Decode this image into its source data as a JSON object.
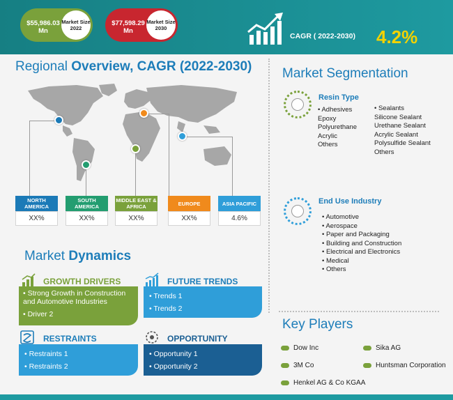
{
  "header": {
    "market_size_2022_value": "$55,986.03 Mn",
    "market_size_2022_label": "Market Size 2022",
    "market_size_2030_value": "$77,598.29 Mn",
    "market_size_2030_label": "Market Size 2030",
    "cagr_label": "CAGR ( 2022-2030)",
    "cagr_value": "4.2%"
  },
  "regional": {
    "title_part1": "Regional ",
    "title_part2": "Overview, CAGR (2022-2030)",
    "regions": [
      {
        "name": "NORTH AMERICA",
        "value": "XX%",
        "color": "#1b7ab7"
      },
      {
        "name": "SOUTH AMERICA",
        "value": "XX%",
        "color": "#239d70"
      },
      {
        "name": "MIDDLE EAST & AFRICA",
        "value": "XX%",
        "color": "#7aa13b"
      },
      {
        "name": "EUROPE",
        "value": "XX%",
        "color": "#f08a1c"
      },
      {
        "name": "ASIA PACIFIC",
        "value": "4.6%",
        "color": "#2f9ed9"
      }
    ]
  },
  "dynamics": {
    "title_part1": "Market ",
    "title_part2": "Dynamics",
    "growth_drivers": {
      "title": "GROWTH DRIVERS",
      "items": [
        "Strong Growth in Construction and Automotive Industries",
        "Driver 2"
      ]
    },
    "future_trends": {
      "title": "FUTURE TRENDS",
      "items": [
        "Trends 1",
        "Trends 2"
      ]
    },
    "restraints": {
      "title": "RESTRAINTS",
      "items": [
        "Restraints 1",
        "Restraints 2"
      ]
    },
    "opportunity": {
      "title": "OPPORTUNITY",
      "items": [
        "Opportunity 1",
        "Opportunity 2"
      ]
    }
  },
  "segmentation": {
    "title": "Market Segmentation",
    "resin": {
      "title": "Resin Type",
      "col1": [
        "Adhesives",
        "Epoxy",
        "Polyurethane",
        "Acrylic",
        "Others"
      ],
      "col2": [
        "Sealants",
        "Silicone Sealant",
        "Urethane Sealant",
        "Acrylic Sealant",
        "Polysulfide Sealant",
        "Others"
      ]
    },
    "end_use": {
      "title": "End Use Industry",
      "items": [
        "Automotive",
        "Aerospace",
        "Paper and Packaging",
        "Building and Construction",
        "Electrical and Electronics",
        "Medical",
        "Others"
      ]
    }
  },
  "key_players": {
    "title": "Key Players",
    "players": [
      "Dow Inc",
      "Sika AG",
      "3M Co",
      "Huntsman Corporation",
      "Henkel AG & Co KGAA"
    ]
  },
  "colors": {
    "teal": "#1e9aa0",
    "blue": "#1d7db9",
    "green": "#7aa13b",
    "red": "#c8262f",
    "orange": "#f08a1c",
    "dark_blue": "#1b5f93",
    "yellow": "#f3d200"
  },
  "icons": [
    "growth-chart-icon",
    "resin-type-icon",
    "end-use-icon",
    "growth-drivers-icon",
    "future-trends-icon",
    "restraints-icon",
    "opportunity-icon"
  ]
}
